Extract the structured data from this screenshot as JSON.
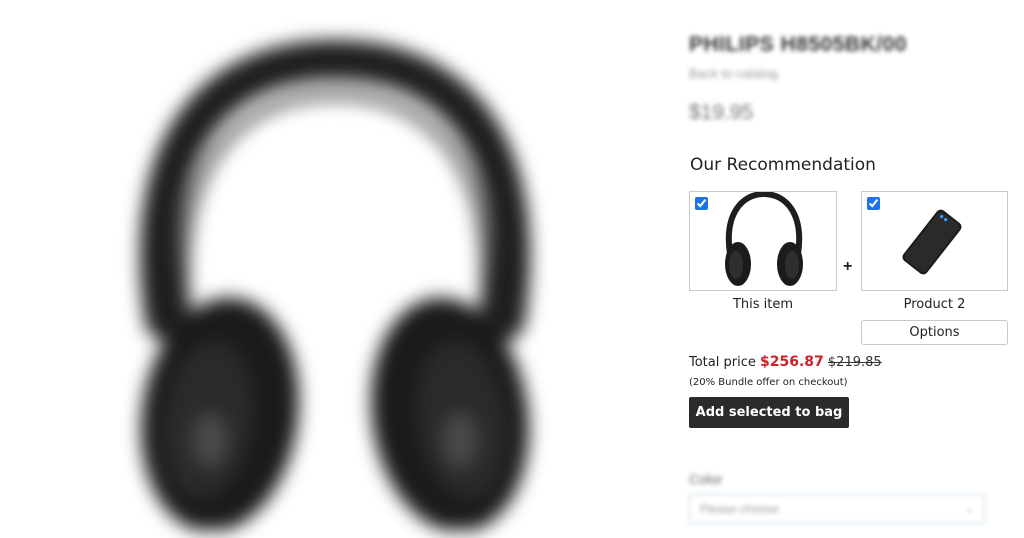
{
  "product": {
    "title": "PHILIPS H8505BK/00",
    "back_link": "Back to catalog",
    "price": "$19.95"
  },
  "recommendation": {
    "title": "Our Recommendation",
    "items": [
      {
        "label": "This item",
        "checked": true,
        "icon": "headphones-thumbnail"
      },
      {
        "label": "Product 2",
        "checked": true,
        "icon": "power-bank-thumbnail"
      }
    ],
    "plus": "+",
    "options_label": "Options",
    "total_label": "Total price",
    "total_price": "$256.87",
    "original_price": "$219.85",
    "bundle_note": "(20% Bundle offer on checkout)",
    "add_button": "Add selected to bag"
  },
  "color": {
    "label": "Color",
    "placeholder": "Please choose"
  },
  "colors": {
    "sale": "#d0202a",
    "button_bg": "#2b2b2b",
    "checkbox": "#1a73e8"
  }
}
